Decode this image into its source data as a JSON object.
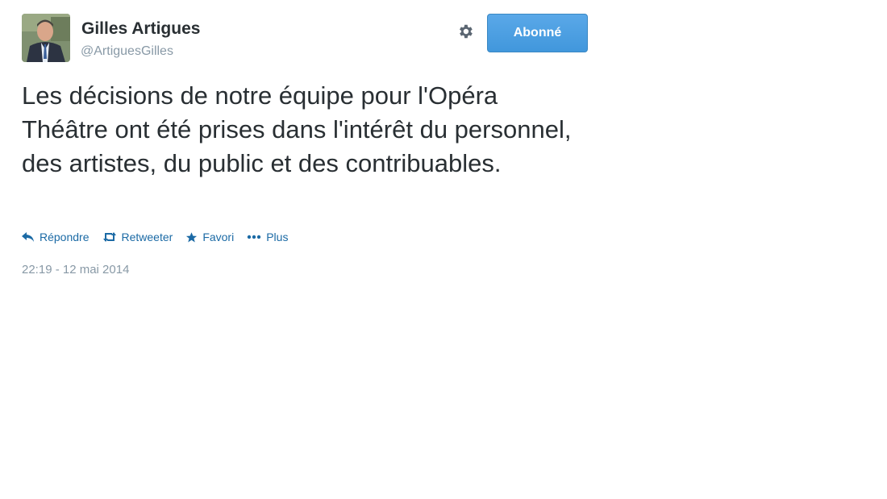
{
  "user": {
    "name": "Gilles Artigues",
    "handle": "@ArtiguesGilles"
  },
  "follow_button": {
    "label": "Abonné",
    "color": "#4a9fe0"
  },
  "tweet": {
    "text": "Les décisions de notre équipe pour l'Opéra Théâtre ont été prises dans l'intérêt du personnel, des artistes, du public et des contribuables.",
    "timestamp": "22:19 - 12 mai 2014"
  },
  "actions": [
    {
      "label": "Répondre",
      "icon": "reply-icon"
    },
    {
      "label": "Retweeter",
      "icon": "retweet-icon"
    },
    {
      "label": "Favori",
      "icon": "star-icon"
    },
    {
      "label": "Plus",
      "icon": "more-icon"
    }
  ],
  "colors": {
    "link": "#1b6aa5",
    "muted": "#8899a6",
    "text": "#292f33"
  }
}
